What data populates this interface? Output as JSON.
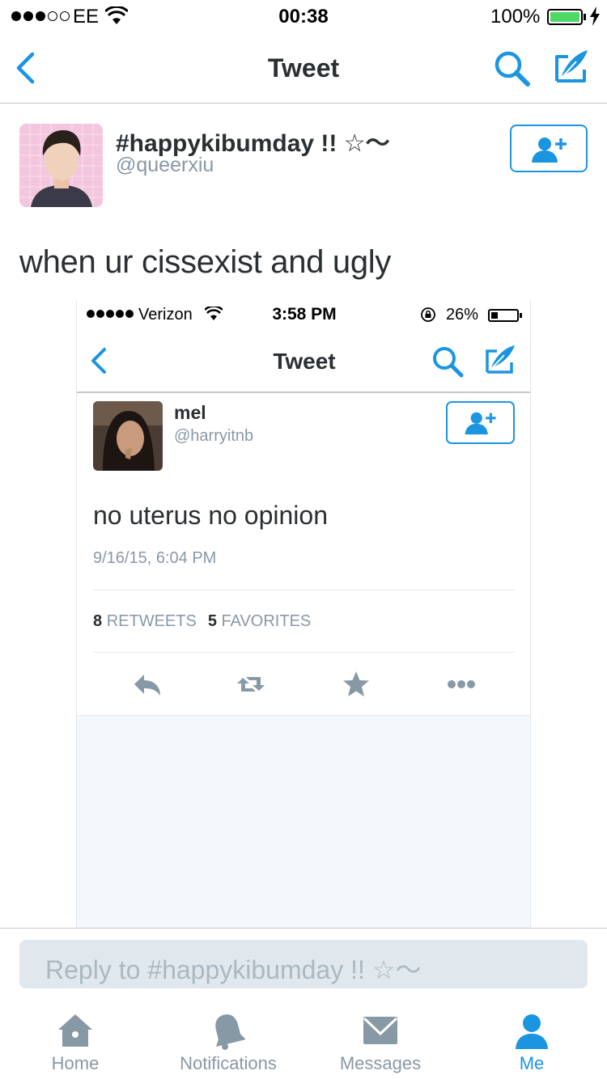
{
  "status_bar": {
    "carrier": "EE",
    "time": "00:38",
    "battery": "100%"
  },
  "nav": {
    "title": "Tweet",
    "icons": [
      "back-chevron-icon",
      "search-icon",
      "compose-icon"
    ]
  },
  "tweet": {
    "display_name": "#happykibumday !! ☆〜",
    "handle": "@queerxiu",
    "text": "when ur cissexist and ugly",
    "follow_icon": "add-user-icon"
  },
  "embedded_screenshot": {
    "status_bar": {
      "carrier": "Verizon",
      "time": "3:58 PM",
      "battery": "26%"
    },
    "nav_title": "Tweet",
    "display_name": "mel",
    "handle": "@harryitnb",
    "text": "no uterus no opinion",
    "date": "9/16/15, 6:04 PM",
    "retweets_count": "8",
    "retweets_label": "RETWEETS",
    "favorites_count": "5",
    "favorites_label": "FAVORITES",
    "action_icons": [
      "reply-icon",
      "retweet-icon",
      "favorite-star-icon",
      "more-icon"
    ]
  },
  "reply": {
    "placeholder": "Reply to #happykibumday !! ☆〜"
  },
  "tabs": [
    {
      "label": "Home",
      "icon": "home-icon",
      "active": false
    },
    {
      "label": "Notifications",
      "icon": "bell-icon",
      "active": false
    },
    {
      "label": "Messages",
      "icon": "envelope-icon",
      "active": false
    },
    {
      "label": "Me",
      "icon": "person-icon",
      "active": true
    }
  ],
  "colors": {
    "twitter_blue": "#1b95e0",
    "gray_text": "#8899a6",
    "dark_text": "#292f33",
    "battery_green": "#4cd964"
  }
}
